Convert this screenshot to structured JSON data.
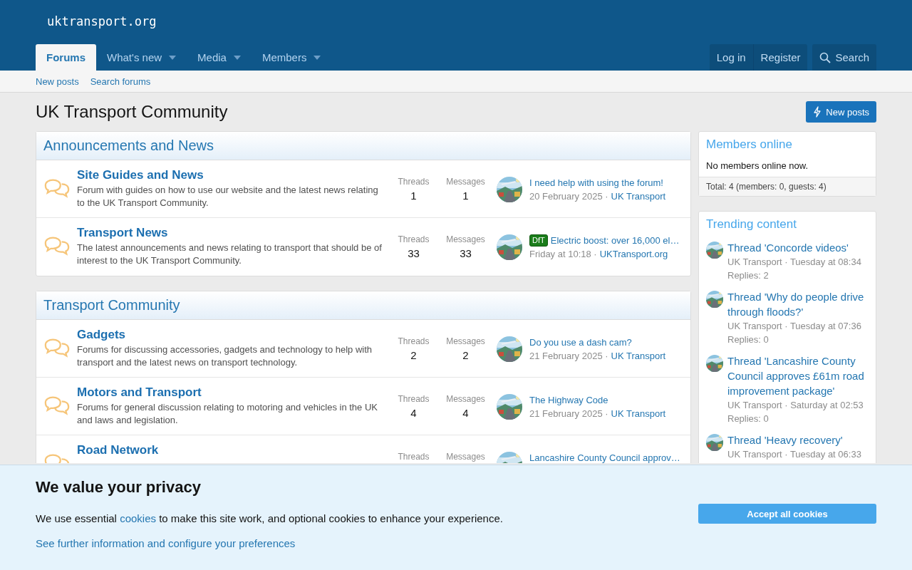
{
  "site": {
    "logo": "uktransport.org"
  },
  "nav": {
    "tabs": [
      {
        "label": "Forums",
        "selected": true,
        "has_menu": false
      },
      {
        "label": "What's new",
        "selected": false,
        "has_menu": true
      },
      {
        "label": "Media",
        "selected": false,
        "has_menu": true
      },
      {
        "label": "Members",
        "selected": false,
        "has_menu": true
      }
    ],
    "account": [
      "Log in",
      "Register"
    ],
    "search": "Search"
  },
  "subnav": [
    "New posts",
    "Search forums"
  ],
  "page_title": "UK Transport Community",
  "new_posts_button": "New posts",
  "categories": [
    {
      "title": "Announcements and News",
      "nodes": [
        {
          "title": "Site Guides and News",
          "description": "Forum with guides on how to use our website and the latest news relating to the UK Transport Community.",
          "threads_label": "Threads",
          "threads": "1",
          "messages_label": "Messages",
          "messages": "1",
          "latest": {
            "title": "I need help with using the forum!",
            "date": "20 February 2025",
            "sep": "·",
            "author": "UK Transport"
          }
        },
        {
          "title": "Transport News",
          "description": "The latest announcements and news relating to transport that should be of interest to the UK Transport Community.",
          "threads_label": "Threads",
          "threads": "33",
          "messages_label": "Messages",
          "messages": "33",
          "latest": {
            "prefix": "DfT",
            "title": "Electric boost: over 16,000 el…",
            "date": "Friday at 10:18",
            "sep": "·",
            "author": "UKTransport.org"
          }
        }
      ]
    },
    {
      "title": "Transport Community",
      "nodes": [
        {
          "title": "Gadgets",
          "description": "Forums for discussing accessories, gadgets and technology to help with transport and the latest news on transport technology.",
          "threads_label": "Threads",
          "threads": "2",
          "messages_label": "Messages",
          "messages": "2",
          "latest": {
            "title": "Do you use a dash cam?",
            "date": "21 February 2025",
            "sep": "·",
            "author": "UK Transport"
          }
        },
        {
          "title": "Motors and Transport",
          "description": "Forums for general discussion relating to motoring and vehicles in the UK and laws and legislation.",
          "threads_label": "Threads",
          "threads": "4",
          "messages_label": "Messages",
          "messages": "4",
          "latest": {
            "title": "The Highway Code",
            "date": "21 February 2025",
            "sep": "·",
            "author": "UK Transport"
          }
        },
        {
          "title": "Road Network",
          "threads_label": "Threads",
          "messages_label": "Messages",
          "latest": {
            "title": "Lancashire County Council approv…"
          }
        }
      ]
    }
  ],
  "sidebar": {
    "members_online": {
      "title": "Members online",
      "text": "No members online now.",
      "total": "Total: 4 (members: 0, guests: 4)"
    },
    "trending": {
      "title": "Trending content",
      "items": [
        {
          "title": "Thread 'Concorde videos'",
          "author": "UK Transport",
          "sep": "·",
          "date": "Tuesday at 08:34",
          "replies": "Replies: 2"
        },
        {
          "title": "Thread 'Why do people drive through floods?'",
          "author": "UK Transport",
          "sep": "·",
          "date": "Tuesday at 07:36",
          "replies": "Replies: 0"
        },
        {
          "title": "Thread 'Lancashire County Council approves £61m road improvement package'",
          "author": "UK Transport",
          "sep": "·",
          "date": "Saturday at 02:53",
          "replies": "Replies: 0"
        },
        {
          "title": "Thread 'Heavy recovery'",
          "author": "UK Transport",
          "sep": "·",
          "date": "Tuesday at 06:33"
        }
      ]
    }
  },
  "cookie": {
    "title": "We value your privacy",
    "text_before": "We use essential ",
    "link": "cookies",
    "text_after": " to make this site work, and optional cookies to enhance your experience.",
    "more_link": "See further information and configure your preferences",
    "accept": "Accept all cookies"
  }
}
